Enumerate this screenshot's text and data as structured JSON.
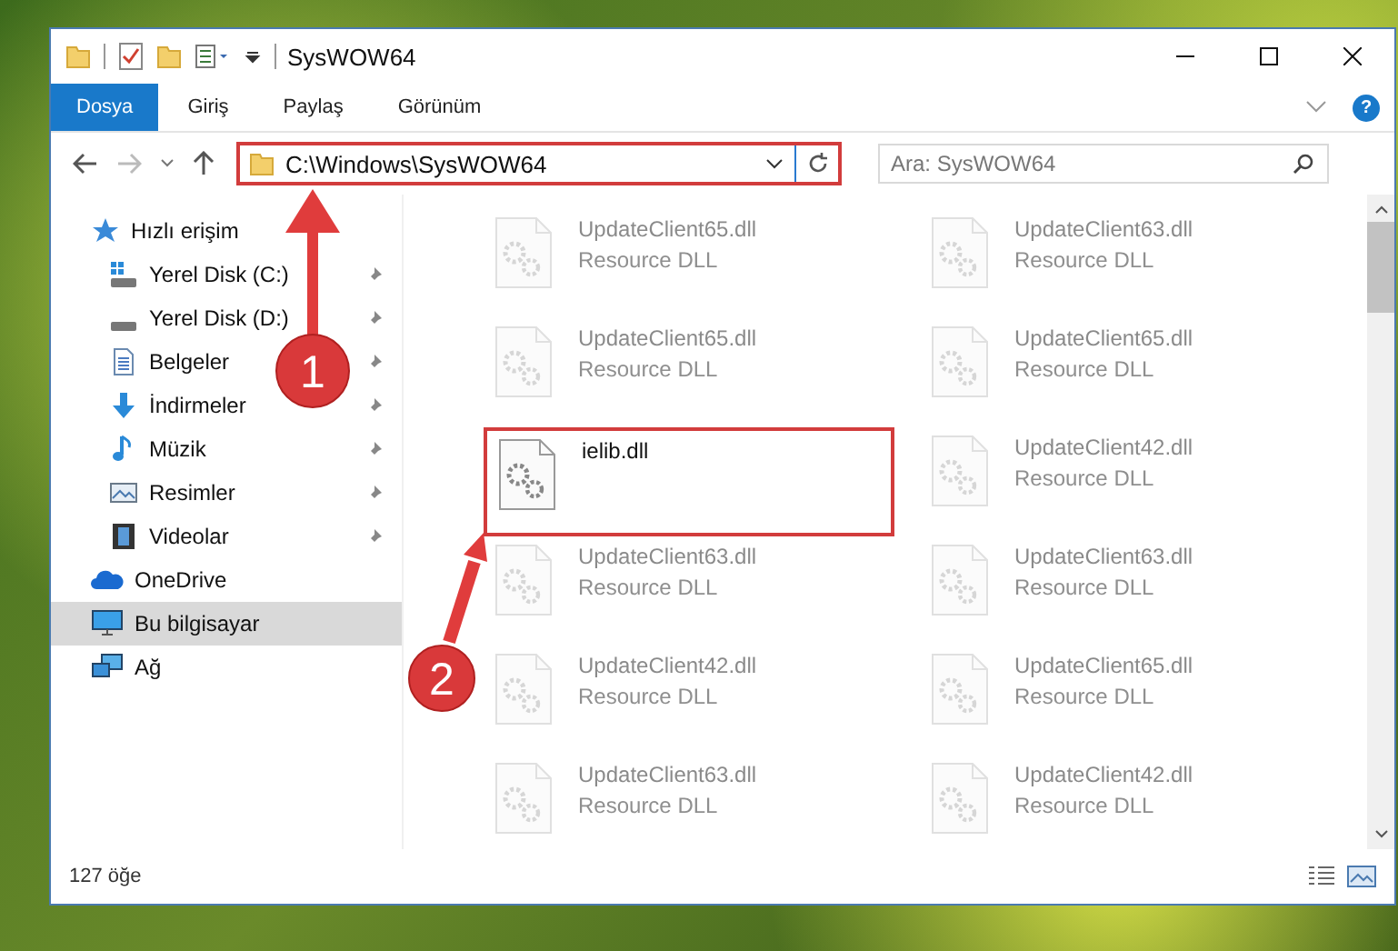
{
  "window": {
    "title": "SysWOW64"
  },
  "ribbon_tabs": [
    {
      "label": "Dosya",
      "selected": true
    },
    {
      "label": "Giriş",
      "selected": false
    },
    {
      "label": "Paylaş",
      "selected": false
    },
    {
      "label": "Görünüm",
      "selected": false
    }
  ],
  "help": "?",
  "address": {
    "path": "C:\\Windows\\SysWOW64",
    "highlighted": true
  },
  "search": {
    "placeholder": "Ara: SysWOW64"
  },
  "sidebar": {
    "items": [
      {
        "label": "Hızlı erişim",
        "kind": "star",
        "selected": false,
        "children": [
          {
            "label": "Yerel Disk (C:)",
            "kind": "drive-win",
            "pinned": true,
            "selected": false
          },
          {
            "label": "Yerel Disk (D:)",
            "kind": "drive",
            "pinned": true,
            "selected": false
          },
          {
            "label": "Belgeler",
            "kind": "documents",
            "pinned": true,
            "selected": false
          },
          {
            "label": "İndirmeler",
            "kind": "downloads",
            "pinned": true,
            "selected": false
          },
          {
            "label": "Müzik",
            "kind": "music",
            "pinned": true,
            "selected": false
          },
          {
            "label": "Resimler",
            "kind": "pictures",
            "pinned": true,
            "selected": false
          },
          {
            "label": "Videolar",
            "kind": "videos",
            "pinned": true,
            "selected": false
          }
        ]
      },
      {
        "label": "OneDrive",
        "kind": "cloud",
        "selected": false
      },
      {
        "label": "Bu bilgisayar",
        "kind": "computer",
        "selected": true
      },
      {
        "label": "Ağ",
        "kind": "network",
        "selected": false
      }
    ]
  },
  "files": [
    {
      "name": "UpdateClient65.dll",
      "type": "Resource DLL",
      "blurred": true,
      "highlighted": false
    },
    {
      "name": "UpdateClient63.dll",
      "type": "Resource DLL",
      "blurred": true,
      "highlighted": false
    },
    {
      "name": "UpdateClient65.dll",
      "type": "Resource DLL",
      "blurred": true,
      "highlighted": false
    },
    {
      "name": "UpdateClient65.dll",
      "type": "Resource DLL",
      "blurred": true,
      "highlighted": false
    },
    {
      "name": "ielib.dll",
      "blurred": false,
      "highlighted": true
    },
    {
      "name": "UpdateClient42.dll",
      "type": "Resource DLL",
      "blurred": true,
      "highlighted": false
    },
    {
      "name": "UpdateClient63.dll",
      "type": "Resource DLL",
      "blurred": true,
      "highlighted": false
    },
    {
      "name": "UpdateClient63.dll",
      "type": "Resource DLL",
      "blurred": true,
      "highlighted": false
    },
    {
      "name": "UpdateClient42.dll",
      "type": "Resource DLL",
      "blurred": true,
      "highlighted": false
    },
    {
      "name": "UpdateClient65.dll",
      "type": "Resource DLL",
      "blurred": true,
      "highlighted": false
    },
    {
      "name": "UpdateClient63.dll",
      "type": "Resource DLL",
      "blurred": true,
      "highlighted": false
    },
    {
      "name": "UpdateClient42.dll",
      "type": "Resource DLL",
      "blurred": true,
      "highlighted": false
    }
  ],
  "status_bar": {
    "count": "127 öğe"
  },
  "annotations": [
    {
      "number": "1"
    },
    {
      "number": "2"
    }
  ]
}
